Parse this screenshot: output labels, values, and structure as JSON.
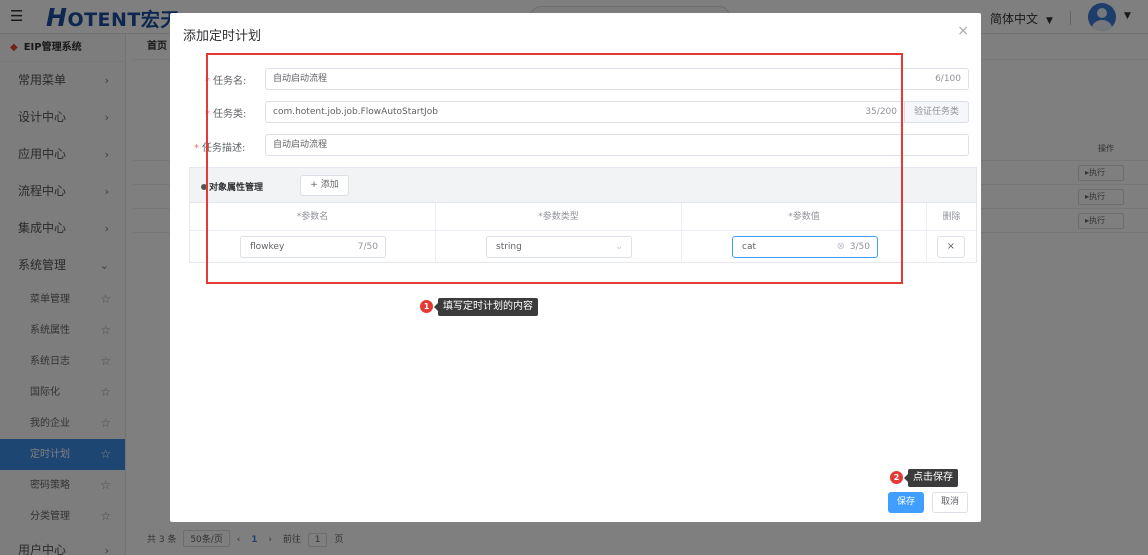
{
  "topbar": {
    "logo_big": "H",
    "logo_rest": "OTENT宏天",
    "language": "简体中文",
    "language_caret": "▼",
    "avatar_caret": "▼"
  },
  "sidebar": {
    "system_title": "EIP管理系统",
    "items": [
      {
        "label": "常用菜单",
        "arrow": "›"
      },
      {
        "label": "设计中心",
        "arrow": "›"
      },
      {
        "label": "应用中心",
        "arrow": "›"
      },
      {
        "label": "流程中心",
        "arrow": "›"
      },
      {
        "label": "集成中心",
        "arrow": "›"
      },
      {
        "label": "系统管理",
        "arrow": "⌄"
      }
    ],
    "sub_items": [
      {
        "label": "菜单管理"
      },
      {
        "label": "系统属性"
      },
      {
        "label": "系统日志"
      },
      {
        "label": "国际化"
      },
      {
        "label": "我的企业"
      },
      {
        "label": "定时计划"
      },
      {
        "label": "密码策略"
      },
      {
        "label": "分类管理"
      }
    ],
    "bottom_item": "用户中心"
  },
  "content": {
    "home_tab": "首页",
    "row_op_label": "▸执行",
    "op_header": "操作",
    "footer": {
      "total": "共 3 条",
      "page_size": "50条/页",
      "current_page": "1",
      "goto_label": "前往",
      "goto_value": "1",
      "page_suffix": "页"
    }
  },
  "dialog": {
    "title": "添加定时计划",
    "close": "×",
    "fields": {
      "task_name": {
        "label": "任务名:",
        "value": "自动启动流程",
        "count": "6/100"
      },
      "task_class": {
        "label": "任务类:",
        "value": "com.hotent.job.job.FlowAutoStartJob",
        "count": "35/200",
        "action": "验证任务类"
      },
      "task_desc": {
        "label": "任务描述:",
        "value": "自动启动流程"
      }
    },
    "props": {
      "title": "对象属性管理",
      "add_label": "+ 添加",
      "headers": {
        "name": "*参数名",
        "type": "*参数类型",
        "value": "*参数值",
        "delete": "删除"
      },
      "row": {
        "name": "flowkey",
        "name_count": "7/50",
        "type": "string",
        "value": "cat",
        "value_count": "3/50",
        "delete": "×"
      }
    },
    "callouts": [
      {
        "num": "1",
        "text": "填写定时计划的内容"
      },
      {
        "num": "2",
        "text": "点击保存"
      }
    ],
    "save_label": "保存",
    "cancel_label": "取消"
  }
}
